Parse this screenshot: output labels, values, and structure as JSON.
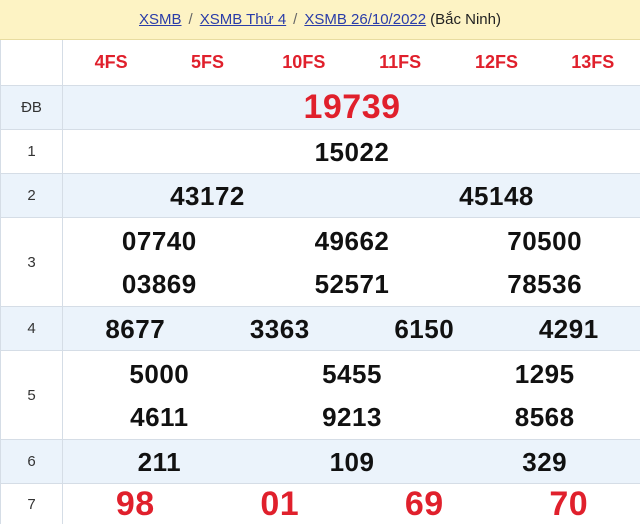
{
  "breadcrumb": {
    "items": [
      "XSMB",
      "XSMB Thứ 4",
      "XSMB 26/10/2022"
    ],
    "separator": "/",
    "region": "(Bắc Ninh)"
  },
  "codes": [
    "4FS",
    "5FS",
    "10FS",
    "11FS",
    "12FS",
    "13FS"
  ],
  "prizes": {
    "db": {
      "label": "ĐB",
      "values": [
        "19739"
      ]
    },
    "p1": {
      "label": "1",
      "values": [
        "15022"
      ]
    },
    "p2": {
      "label": "2",
      "values": [
        "43172",
        "45148"
      ]
    },
    "p3": {
      "label": "3",
      "values": [
        "07740",
        "49662",
        "70500",
        "03869",
        "52571",
        "78536"
      ]
    },
    "p4": {
      "label": "4",
      "values": [
        "8677",
        "3363",
        "6150",
        "4291"
      ]
    },
    "p5": {
      "label": "5",
      "values": [
        "5000",
        "5455",
        "1295",
        "4611",
        "9213",
        "8568"
      ]
    },
    "p6": {
      "label": "6",
      "values": [
        "211",
        "109",
        "329"
      ]
    },
    "p7": {
      "label": "7",
      "values": [
        "98",
        "01",
        "69",
        "70"
      ]
    }
  },
  "colors": {
    "accent_red": "#e0202c",
    "header_bg": "#fdf3c4",
    "alt_row_bg": "#ebf3fb",
    "link": "#2a3ca8"
  }
}
